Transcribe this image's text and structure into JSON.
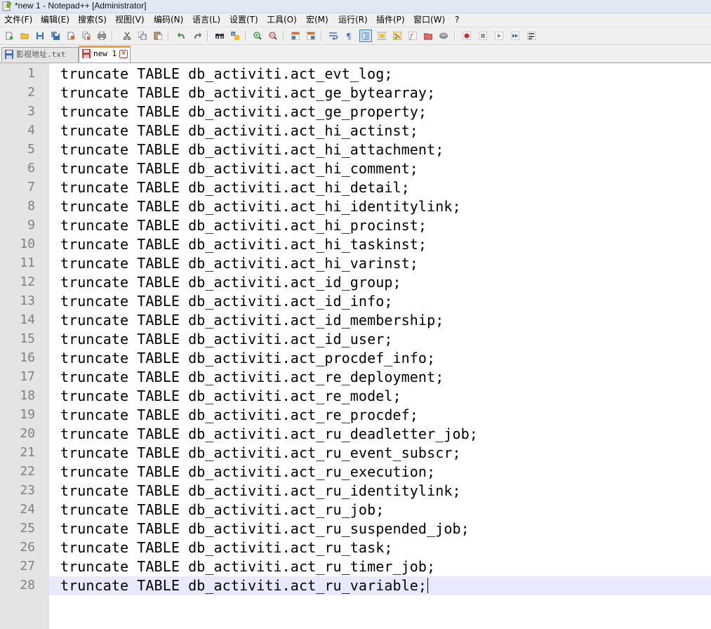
{
  "window": {
    "title": "*new 1 - Notepad++ [Administrator]"
  },
  "menu": {
    "items": [
      "文件(F)",
      "编辑(E)",
      "搜索(S)",
      "视图(V)",
      "编码(N)",
      "语言(L)",
      "设置(T)",
      "工具(O)",
      "宏(M)",
      "运行(R)",
      "插件(P)",
      "窗口(W)",
      "?"
    ]
  },
  "toolbar": {
    "icons": [
      "new-file-icon",
      "open-file-icon",
      "save-icon",
      "save-all-icon",
      "close-icon",
      "close-all-icon",
      "print-icon",
      "cut-icon",
      "copy-icon",
      "paste-icon",
      "undo-icon",
      "redo-icon",
      "find-icon",
      "replace-icon",
      "zoom-in-icon",
      "zoom-out-icon",
      "sync-vertical-icon",
      "sync-horizontal-icon",
      "word-wrap-icon",
      "show-all-chars-icon",
      "indent-guide-icon",
      "user-language-icon",
      "doc-map-icon",
      "function-list-icon",
      "folder-as-workspace-icon",
      "monitoring-icon",
      "record-macro-icon",
      "stop-record-icon",
      "playback-icon",
      "run-macro-multiple-icon",
      "save-macro-icon"
    ]
  },
  "tabs": [
    {
      "label": "影视地址.txt",
      "active": false
    },
    {
      "label": "new 1",
      "active": true
    }
  ],
  "editor": {
    "current_line": 28,
    "lines": [
      {
        "n": "1",
        "text": "truncate TABLE db_activiti.act_evt_log;"
      },
      {
        "n": "2",
        "text": "truncate TABLE db_activiti.act_ge_bytearray;"
      },
      {
        "n": "3",
        "text": "truncate TABLE db_activiti.act_ge_property;"
      },
      {
        "n": "4",
        "text": "truncate TABLE db_activiti.act_hi_actinst;"
      },
      {
        "n": "5",
        "text": "truncate TABLE db_activiti.act_hi_attachment;"
      },
      {
        "n": "6",
        "text": "truncate TABLE db_activiti.act_hi_comment;"
      },
      {
        "n": "7",
        "text": "truncate TABLE db_activiti.act_hi_detail;"
      },
      {
        "n": "8",
        "text": "truncate TABLE db_activiti.act_hi_identitylink;"
      },
      {
        "n": "9",
        "text": "truncate TABLE db_activiti.act_hi_procinst;"
      },
      {
        "n": "10",
        "text": "truncate TABLE db_activiti.act_hi_taskinst;"
      },
      {
        "n": "11",
        "text": "truncate TABLE db_activiti.act_hi_varinst;"
      },
      {
        "n": "12",
        "text": "truncate TABLE db_activiti.act_id_group;"
      },
      {
        "n": "13",
        "text": "truncate TABLE db_activiti.act_id_info;"
      },
      {
        "n": "14",
        "text": "truncate TABLE db_activiti.act_id_membership;"
      },
      {
        "n": "15",
        "text": "truncate TABLE db_activiti.act_id_user;"
      },
      {
        "n": "16",
        "text": "truncate TABLE db_activiti.act_procdef_info;"
      },
      {
        "n": "17",
        "text": "truncate TABLE db_activiti.act_re_deployment;"
      },
      {
        "n": "18",
        "text": "truncate TABLE db_activiti.act_re_model;"
      },
      {
        "n": "19",
        "text": "truncate TABLE db_activiti.act_re_procdef;"
      },
      {
        "n": "20",
        "text": "truncate TABLE db_activiti.act_ru_deadletter_job;"
      },
      {
        "n": "21",
        "text": "truncate TABLE db_activiti.act_ru_event_subscr;"
      },
      {
        "n": "22",
        "text": "truncate TABLE db_activiti.act_ru_execution;"
      },
      {
        "n": "23",
        "text": "truncate TABLE db_activiti.act_ru_identitylink;"
      },
      {
        "n": "24",
        "text": "truncate TABLE db_activiti.act_ru_job;"
      },
      {
        "n": "25",
        "text": "truncate TABLE db_activiti.act_ru_suspended_job;"
      },
      {
        "n": "26",
        "text": "truncate TABLE db_activiti.act_ru_task;"
      },
      {
        "n": "27",
        "text": "truncate TABLE db_activiti.act_ru_timer_job;"
      },
      {
        "n": "28",
        "text": "truncate TABLE db_activiti.act_ru_variable;"
      }
    ]
  },
  "colors": {
    "gutter_bg": "#e4e4e4",
    "current_line_bg": "#e8e8ff",
    "active_tab_accent": "#f39c34"
  }
}
